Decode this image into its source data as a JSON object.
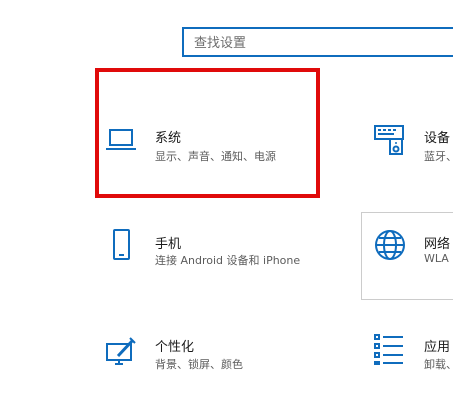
{
  "search": {
    "placeholder": "查找设置"
  },
  "tiles": {
    "system": {
      "title": "系统",
      "desc": "显示、声音、通知、电源",
      "icon": "laptop-icon"
    },
    "devices": {
      "title": "设备",
      "desc": "蓝牙、",
      "icon": "keyboard-speaker-icon"
    },
    "phone": {
      "title": "手机",
      "desc": "连接 Android 设备和 iPhone",
      "icon": "phone-icon"
    },
    "network": {
      "title": "网络",
      "desc": "WLA",
      "icon": "globe-icon"
    },
    "personal": {
      "title": "个性化",
      "desc": "背景、锁屏、颜色",
      "icon": "paint-monitor-icon"
    },
    "apps": {
      "title": "应用",
      "desc": "卸载、",
      "icon": "apps-list-icon"
    }
  },
  "colors": {
    "accent": "#0f6cbd",
    "highlight": "#e00a0a"
  }
}
